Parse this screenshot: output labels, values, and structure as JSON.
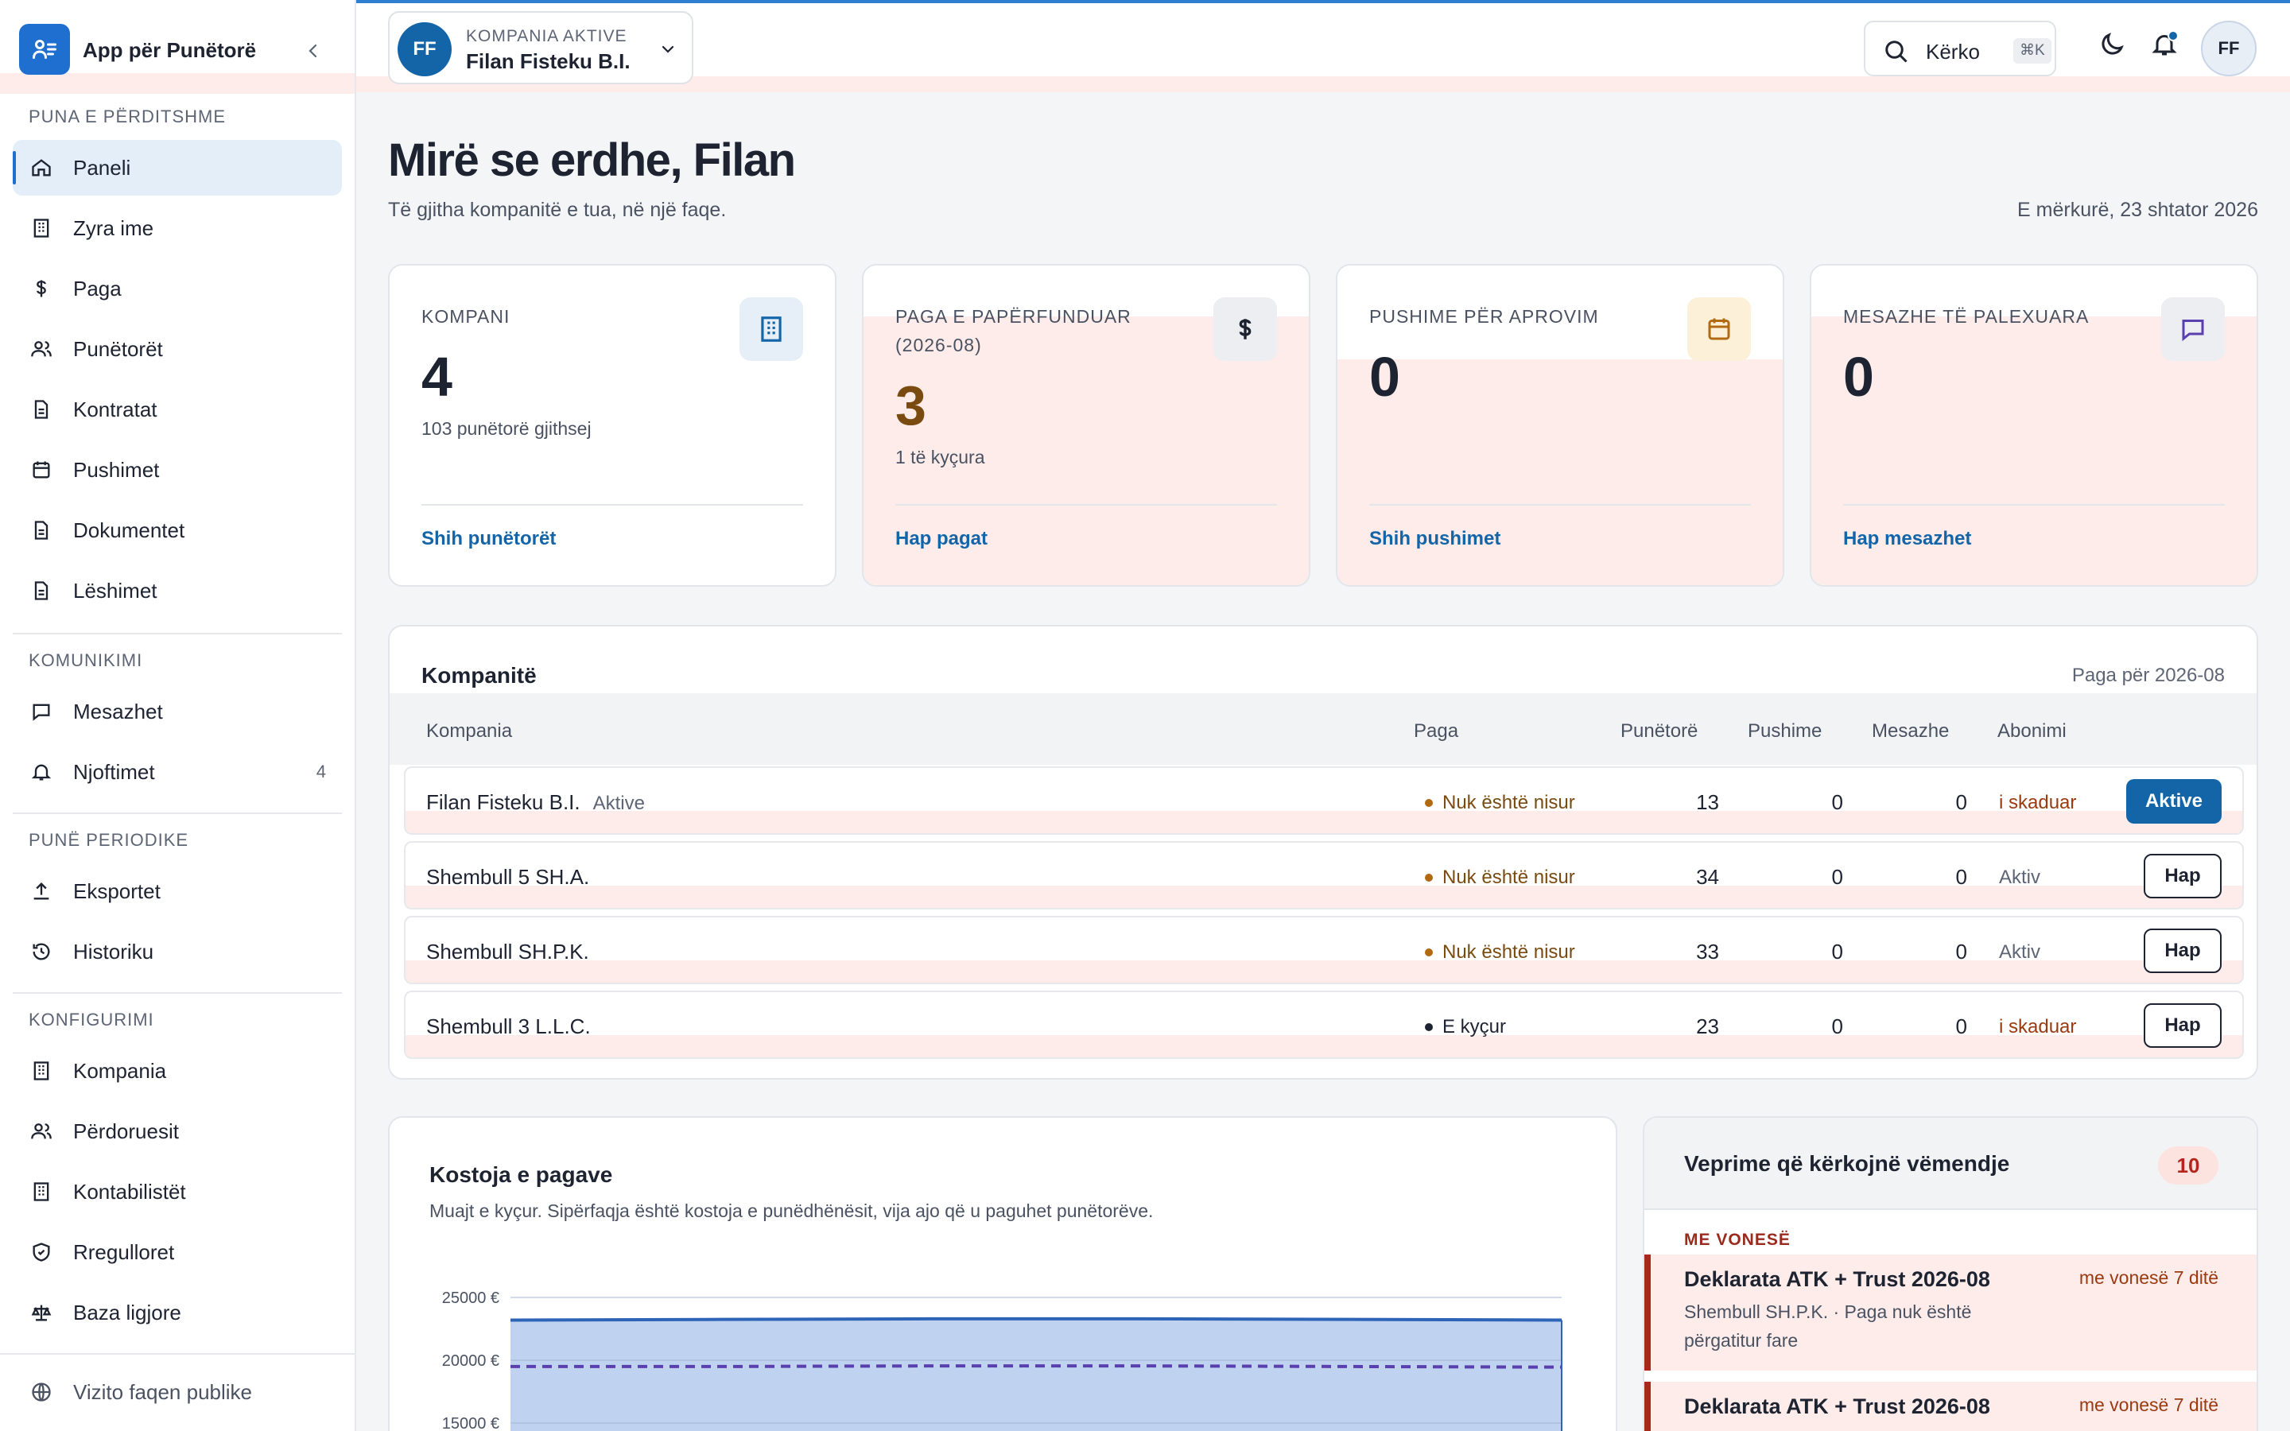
{
  "app": {
    "name": "App për Punëtorë"
  },
  "sidebar": {
    "sections": [
      {
        "label": "Puna e përditshme"
      },
      {
        "label": "Komunikimi"
      },
      {
        "label": "Punë periodike"
      },
      {
        "label": "Konfigurimi"
      }
    ],
    "items": [
      {
        "label": "Paneli",
        "icon": "home-icon"
      },
      {
        "label": "Zyra ime",
        "icon": "building-icon"
      },
      {
        "label": "Paga",
        "icon": "dollar-icon"
      },
      {
        "label": "Punëtorët",
        "icon": "users-icon"
      },
      {
        "label": "Kontratat",
        "icon": "document-icon"
      },
      {
        "label": "Pushimet",
        "icon": "calendar-icon"
      },
      {
        "label": "Dokumentet",
        "icon": "document-icon"
      },
      {
        "label": "Lëshimet",
        "icon": "document-icon"
      },
      {
        "label": "Mesazhet",
        "icon": "message-icon"
      },
      {
        "label": "Njoftimet",
        "icon": "bell-icon",
        "badge": "4"
      },
      {
        "label": "Eksportet",
        "icon": "upload-icon"
      },
      {
        "label": "Historiku",
        "icon": "history-icon"
      },
      {
        "label": "Kompania",
        "icon": "building-icon"
      },
      {
        "label": "Përdoruesit",
        "icon": "users-icon"
      },
      {
        "label": "Kontabilistët",
        "icon": "building-icon"
      },
      {
        "label": "Rregulloret",
        "icon": "shield-icon"
      },
      {
        "label": "Baza ligjore",
        "icon": "scale-icon"
      }
    ],
    "footer": {
      "label": "Vizito faqen publike",
      "icon": "globe-icon"
    }
  },
  "topbar": {
    "company": {
      "initials": "FF",
      "label": "Kompania aktive",
      "name": "Filan Fisteku B.I."
    },
    "search": {
      "label": "Kërko",
      "shortcut": "⌘K"
    },
    "user_initials": "FF"
  },
  "main": {
    "welcome": "Mirë se erdhe, Filan",
    "subtitle": "Të gjitha kompanitë e tua, në një faqe.",
    "date": "E mërkurë, 23 shtator 2026"
  },
  "stats": [
    {
      "label": "Kompani",
      "value": "4",
      "sub": "103 punëtorë gjithsej",
      "link": "Shih punëtorët",
      "icon": "building-icon"
    },
    {
      "label": "Paga e papërfunduar (2026-08)",
      "value": "3",
      "sub": "1 të kyçura",
      "link": "Hap pagat",
      "icon": "dollar-icon"
    },
    {
      "label": "Pushime për aprovim",
      "value": "0",
      "sub": "",
      "link": "Shih pushimet",
      "icon": "calendar-icon"
    },
    {
      "label": "Mesazhe të palexuara",
      "value": "0",
      "sub": "",
      "link": "Hap mesazhet",
      "icon": "message-icon"
    }
  ],
  "companies": {
    "title": "Kompanitë",
    "period": "Paga për 2026-08",
    "columns": [
      "Kompania",
      "Paga",
      "Punëtorë",
      "Pushime",
      "Mesazhe",
      "Abonimi"
    ],
    "rows": [
      {
        "name": "Filan Fisteku B.I.",
        "tag": "Aktive",
        "pay_status": "Nuk është nisur",
        "workers": "13",
        "leaves": "0",
        "messages": "0",
        "subscription": "i skaduar",
        "action": "Aktive"
      },
      {
        "name": "Shembull 5 SH.A.",
        "tag": "",
        "pay_status": "Nuk është nisur",
        "workers": "34",
        "leaves": "0",
        "messages": "0",
        "subscription": "Aktiv",
        "action": "Hap"
      },
      {
        "name": "Shembull SH.P.K.",
        "tag": "",
        "pay_status": "Nuk është nisur",
        "workers": "33",
        "leaves": "0",
        "messages": "0",
        "subscription": "Aktiv",
        "action": "Hap"
      },
      {
        "name": "Shembull 3 L.L.C.",
        "tag": "",
        "pay_status": "E kyçur",
        "workers": "23",
        "leaves": "0",
        "messages": "0",
        "subscription": "i skaduar",
        "action": "Hap"
      }
    ]
  },
  "cost_chart": {
    "title": "Kostoja e pagave",
    "subtitle": "Muajt e kyçur. Sipërfaqja është kostoja e punëdhënësit, vija ajo që u paguhet punëtorëve."
  },
  "chart_data": {
    "type": "area",
    "title": "Kostoja e pagave",
    "y_tick_labels": [
      "25000 €",
      "20000 €",
      "15000 €"
    ],
    "y_ticks": [
      25000,
      20000,
      15000
    ],
    "ylim": [
      15000,
      26000
    ],
    "grid": true,
    "series": [
      {
        "values": [
          23200,
          23250,
          23300,
          23300,
          23250,
          23200
        ],
        "color": "#2e64b8"
      },
      {
        "values": [
          19500,
          19500,
          19550,
          19550,
          19500,
          19450
        ],
        "color": "#5a3fae"
      }
    ]
  },
  "actions": {
    "title": "Veprime që kërkojnë vëmendje",
    "count": "10",
    "section": "Me vonesë",
    "items": [
      {
        "title": "Deklarata ATK + Trust 2026-08",
        "desc": "Shembull SH.P.K. · Paga nuk është përgatitur fare",
        "late": "me vonesë 7 ditë"
      },
      {
        "title": "Deklarata ATK + Trust 2026-08",
        "desc": "",
        "late": "me vonesë 7 ditë"
      }
    ]
  },
  "colors": {
    "accent": "#1465a8",
    "brand": "#1f6fd1",
    "danger": "#a8281e",
    "warning": "#b26a12"
  }
}
